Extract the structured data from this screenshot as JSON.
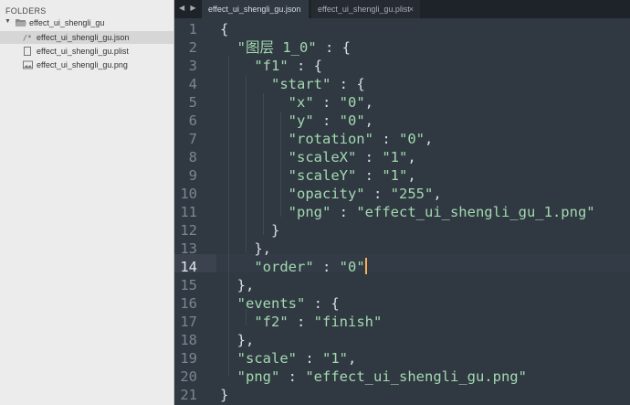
{
  "sidebar": {
    "header": "FOLDERS",
    "root_folder": "effect_ui_shengli_gu",
    "files": [
      {
        "name": "effect_ui_shengli_gu.json",
        "icon": "code-file-icon",
        "selected": true
      },
      {
        "name": "effect_ui_shengli_gu.plist",
        "icon": "file-icon",
        "selected": false
      },
      {
        "name": "effect_ui_shengli_gu.png",
        "icon": "image-file-icon",
        "selected": false
      }
    ]
  },
  "tabs": [
    {
      "label": "effect_ui_shengli_gu.json",
      "active": true
    },
    {
      "label": "effect_ui_shengli_gu.plist",
      "active": false,
      "close": "×"
    }
  ],
  "nav": {
    "arrows": "◀ ▶"
  },
  "editor": {
    "active_line": 14,
    "line_numbers": [
      "1",
      "2",
      "3",
      "4",
      "5",
      "6",
      "7",
      "8",
      "9",
      "10",
      "11",
      "12",
      "13",
      "14",
      "15",
      "16",
      "17",
      "18",
      "19",
      "20",
      "21"
    ],
    "lines": [
      [
        [
          "p",
          "{"
        ]
      ],
      [
        [
          "p",
          "  "
        ],
        [
          "k",
          "\"图层 1_0\""
        ],
        [
          "p",
          " : {"
        ]
      ],
      [
        [
          "p",
          "    "
        ],
        [
          "k",
          "\"f1\""
        ],
        [
          "p",
          " : {"
        ]
      ],
      [
        [
          "p",
          "      "
        ],
        [
          "k",
          "\"start\""
        ],
        [
          "p",
          " : {"
        ]
      ],
      [
        [
          "p",
          "        "
        ],
        [
          "k",
          "\"x\""
        ],
        [
          "p",
          " : "
        ],
        [
          "s",
          "\"0\""
        ],
        [
          "p",
          ","
        ]
      ],
      [
        [
          "p",
          "        "
        ],
        [
          "k",
          "\"y\""
        ],
        [
          "p",
          " : "
        ],
        [
          "s",
          "\"0\""
        ],
        [
          "p",
          ","
        ]
      ],
      [
        [
          "p",
          "        "
        ],
        [
          "k",
          "\"rotation\""
        ],
        [
          "p",
          " : "
        ],
        [
          "s",
          "\"0\""
        ],
        [
          "p",
          ","
        ]
      ],
      [
        [
          "p",
          "        "
        ],
        [
          "k",
          "\"scaleX\""
        ],
        [
          "p",
          " : "
        ],
        [
          "s",
          "\"1\""
        ],
        [
          "p",
          ","
        ]
      ],
      [
        [
          "p",
          "        "
        ],
        [
          "k",
          "\"scaleY\""
        ],
        [
          "p",
          " : "
        ],
        [
          "s",
          "\"1\""
        ],
        [
          "p",
          ","
        ]
      ],
      [
        [
          "p",
          "        "
        ],
        [
          "k",
          "\"opacity\""
        ],
        [
          "p",
          " : "
        ],
        [
          "s",
          "\"255\""
        ],
        [
          "p",
          ","
        ]
      ],
      [
        [
          "p",
          "        "
        ],
        [
          "k",
          "\"png\""
        ],
        [
          "p",
          " : "
        ],
        [
          "s",
          "\"effect_ui_shengli_gu_1.png\""
        ]
      ],
      [
        [
          "p",
          "      }"
        ]
      ],
      [
        [
          "p",
          "    },"
        ]
      ],
      [
        [
          "p",
          "    "
        ],
        [
          "k",
          "\"order\""
        ],
        [
          "p",
          " : "
        ],
        [
          "s",
          "\"0\""
        ]
      ],
      [
        [
          "p",
          "  },"
        ]
      ],
      [
        [
          "p",
          "  "
        ],
        [
          "k",
          "\"events\""
        ],
        [
          "p",
          " : {"
        ]
      ],
      [
        [
          "p",
          "    "
        ],
        [
          "k",
          "\"f2\""
        ],
        [
          "p",
          " : "
        ],
        [
          "s",
          "\"finish\""
        ]
      ],
      [
        [
          "p",
          "  },"
        ]
      ],
      [
        [
          "p",
          "  "
        ],
        [
          "k",
          "\"scale\""
        ],
        [
          "p",
          " : "
        ],
        [
          "s",
          "\"1\""
        ],
        [
          "p",
          ","
        ]
      ],
      [
        [
          "p",
          "  "
        ],
        [
          "k",
          "\"png\""
        ],
        [
          "p",
          " : "
        ],
        [
          "s",
          "\"effect_ui_shengli_gu.png\""
        ]
      ],
      [
        [
          "p",
          "}"
        ]
      ]
    ]
  },
  "colors": {
    "editor_bg": "#303841",
    "key_color": "#a3d9b1",
    "punct_color": "#d8dee9",
    "caret": "#f9ae58",
    "sidebar_bg": "#ececec"
  }
}
